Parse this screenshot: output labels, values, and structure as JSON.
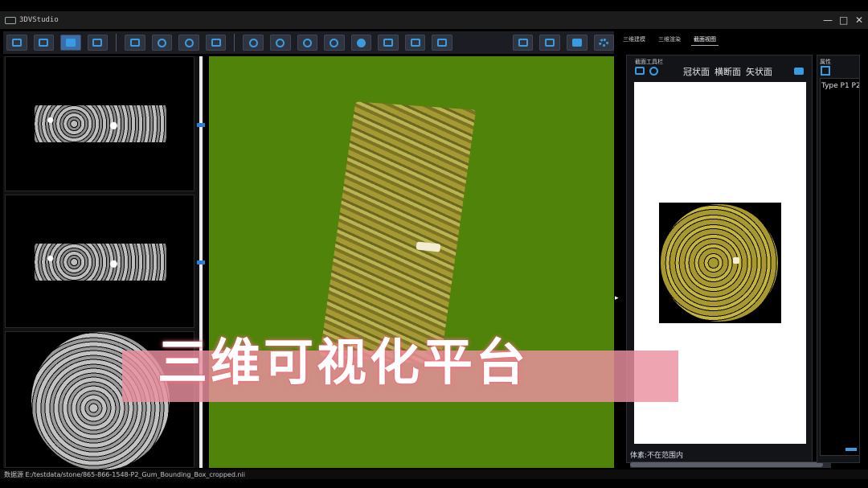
{
  "window": {
    "title": "3DVStudio",
    "controls": [
      "—",
      "□",
      "✕"
    ]
  },
  "toolbar": {
    "buttons": [
      {
        "name": "open-image",
        "icon": "image-icon"
      },
      {
        "name": "print",
        "icon": "printer-icon"
      },
      {
        "name": "cube-view",
        "icon": "cube-icon",
        "active": true
      },
      {
        "name": "frame",
        "icon": "frame-icon"
      },
      {
        "name": "save",
        "icon": "save-icon"
      },
      {
        "name": "target",
        "icon": "crosshair-icon"
      },
      {
        "name": "cut",
        "icon": "scissors-icon"
      },
      {
        "name": "save-as",
        "icon": "disk-icon"
      },
      {
        "name": "pan",
        "icon": "hand-icon"
      },
      {
        "name": "rotate",
        "icon": "rotate-icon"
      },
      {
        "name": "zoom",
        "icon": "zoom-icon"
      },
      {
        "name": "user",
        "icon": "person-icon"
      },
      {
        "name": "contrast",
        "icon": "contrast-icon"
      },
      {
        "name": "brush",
        "icon": "brush-icon"
      },
      {
        "name": "chart",
        "icon": "chart-icon"
      },
      {
        "name": "comment",
        "icon": "comment-icon"
      },
      {
        "name": "lock",
        "icon": "lock-icon"
      },
      {
        "name": "unlock",
        "icon": "unlock-icon"
      },
      {
        "name": "camera",
        "icon": "camera-icon"
      },
      {
        "name": "settings",
        "icon": "gear-icon"
      }
    ],
    "accent": "#3a9be0"
  },
  "right_tabs": [
    {
      "label": "三维建模",
      "active": false
    },
    {
      "label": "三维渲染",
      "active": false
    },
    {
      "label": "截面视图",
      "active": true
    }
  ],
  "section_panel": {
    "group_label": "截面工具栏",
    "planes": [
      "冠状面",
      "横断面",
      "矢状面"
    ],
    "status": "体素:不在范围内"
  },
  "properties_panel": {
    "group_label": "属性",
    "header": "Type P1 P2"
  },
  "viewport": {
    "background": "#4f8309",
    "overlay_title": "三维可视化平台"
  },
  "statusbar": {
    "text": "数据源 E:/testdata/stone/865-866-1548-P2_Gum_Bounding_Box_cropped.nii"
  }
}
